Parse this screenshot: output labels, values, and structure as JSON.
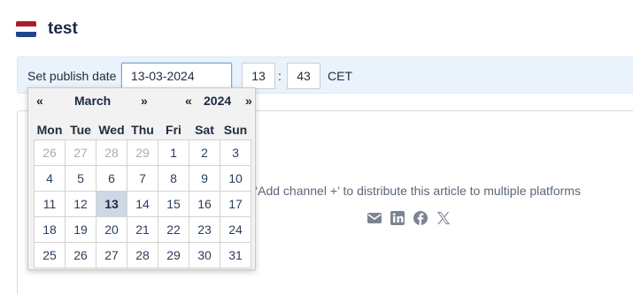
{
  "article": {
    "title": "test"
  },
  "publish": {
    "label": "Set publish date",
    "date": "13-03-2024",
    "hour": "13",
    "separator": ":",
    "minute": "43",
    "timezone": "CET"
  },
  "flag_colors": [
    "#ae1c28",
    "#ffffff",
    "#21468b"
  ],
  "info": {
    "hint": "‘Add channel +’ to distribute this article to multiple platforms"
  },
  "share_icons": [
    "mail-icon",
    "linkedin-icon",
    "facebook-icon",
    "x-icon"
  ],
  "calendar": {
    "prev_month": "«",
    "month": "March",
    "next_month": "»",
    "prev_year": "«",
    "year": "2024",
    "next_year": "»",
    "weekdays": [
      "Mon",
      "Tue",
      "Wed",
      "Thu",
      "Fri",
      "Sat",
      "Sun"
    ],
    "weeks": [
      [
        "26",
        "27",
        "28",
        "29",
        "1",
        "2",
        "3"
      ],
      [
        "4",
        "5",
        "6",
        "7",
        "8",
        "9",
        "10"
      ],
      [
        "11",
        "12",
        "13",
        "14",
        "15",
        "16",
        "17"
      ],
      [
        "18",
        "19",
        "20",
        "21",
        "22",
        "23",
        "24"
      ],
      [
        "25",
        "26",
        "27",
        "28",
        "29",
        "30",
        "31"
      ]
    ],
    "outside_days": [
      [
        0,
        0
      ],
      [
        0,
        1
      ],
      [
        0,
        2
      ],
      [
        0,
        3
      ]
    ],
    "selected": [
      2,
      2
    ]
  }
}
